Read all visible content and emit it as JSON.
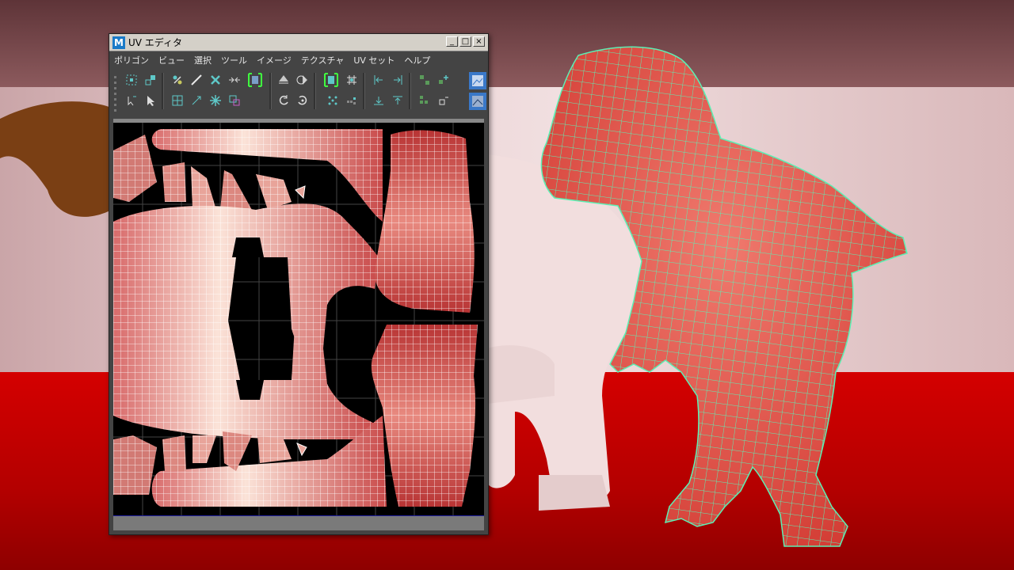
{
  "window": {
    "app_logo": "M",
    "title": "UV エディタ",
    "minimize": "_",
    "maximize": "□",
    "close": "×"
  },
  "menu": [
    "ポリゴン",
    "ビュー",
    "選択",
    "ツール",
    "イメージ",
    "テクスチャ",
    "UV セット",
    "ヘルプ"
  ],
  "toolbar": {
    "row1": [
      "grid-select-icon",
      "move-uv-icon",
      "cut-tool-icon",
      "delete-icon",
      "mirror-icon",
      "frame-icon",
      "flip-u-icon",
      "flip-v-icon",
      "frame-selected-icon",
      "snap-grid-icon",
      "align-left-icon",
      "align-right-icon",
      "layout-icon",
      "add-point-icon",
      "texture-preview-icon"
    ],
    "row2": [
      "select-cursor-icon",
      "select-arrow-icon",
      "grid-edit-icon",
      "brush-icon",
      "snowflake-icon",
      "shell-icon",
      "rotate-ccw-icon",
      "rotate-cw-icon",
      "distribute-icon",
      "checker-icon",
      "align-bottom-icon",
      "align-top-icon",
      "stack-icon",
      "corner-icon",
      "image-icon"
    ]
  },
  "colors": {
    "maya_menu_bg": "#444444",
    "titlebar_bg": "#d4d0c8",
    "wireframe_active": "#5cf0b4",
    "uv_line": "#ffffff",
    "floor": "#c80000"
  }
}
